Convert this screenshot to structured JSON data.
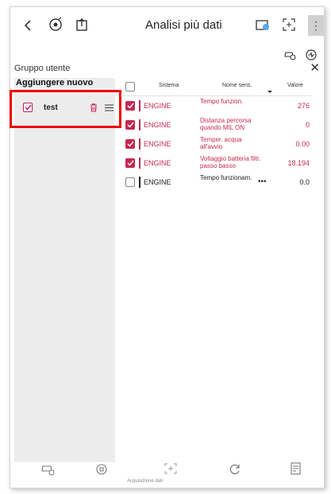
{
  "header": {
    "title": "Analisi più dati"
  },
  "group_panel": {
    "label": "Gruppo utente",
    "add_new": "Aggiungere nuovo gruppo",
    "group_name": "test"
  },
  "table": {
    "headers": {
      "system": "Sistema",
      "sensor": "Nome sens.",
      "value": "Valore"
    },
    "rows": [
      {
        "checked": true,
        "system": "ENGINE",
        "sensor": "Tempo funzion.",
        "value": "276"
      },
      {
        "checked": true,
        "system": "ENGINE",
        "sensor": "Distanza percorsa quando MIL ON",
        "value": "0"
      },
      {
        "checked": true,
        "system": "ENGINE",
        "sensor": "Temper. acqua all'avvio",
        "value": "0.00"
      },
      {
        "checked": true,
        "system": "ENGINE",
        "sensor": "Voltaggio batteria filtr. passo basso",
        "value": "18.194"
      },
      {
        "checked": false,
        "system": "ENGINE",
        "sensor": "Tempo funzionam.",
        "value": "0.0"
      }
    ]
  },
  "bottom": {
    "label": "Acquisizione dati"
  },
  "colors": {
    "accent": "#c62850",
    "highlight": "#ee0000",
    "sidebar": "#ececec"
  },
  "icons": [
    "back-icon",
    "vehicle-info-icon",
    "export-icon",
    "camera-icon",
    "fullscreen-icon",
    "more-icon",
    "car-check-icon",
    "ecu-icon",
    "close-icon",
    "delete-icon",
    "drag-handle-icon"
  ]
}
